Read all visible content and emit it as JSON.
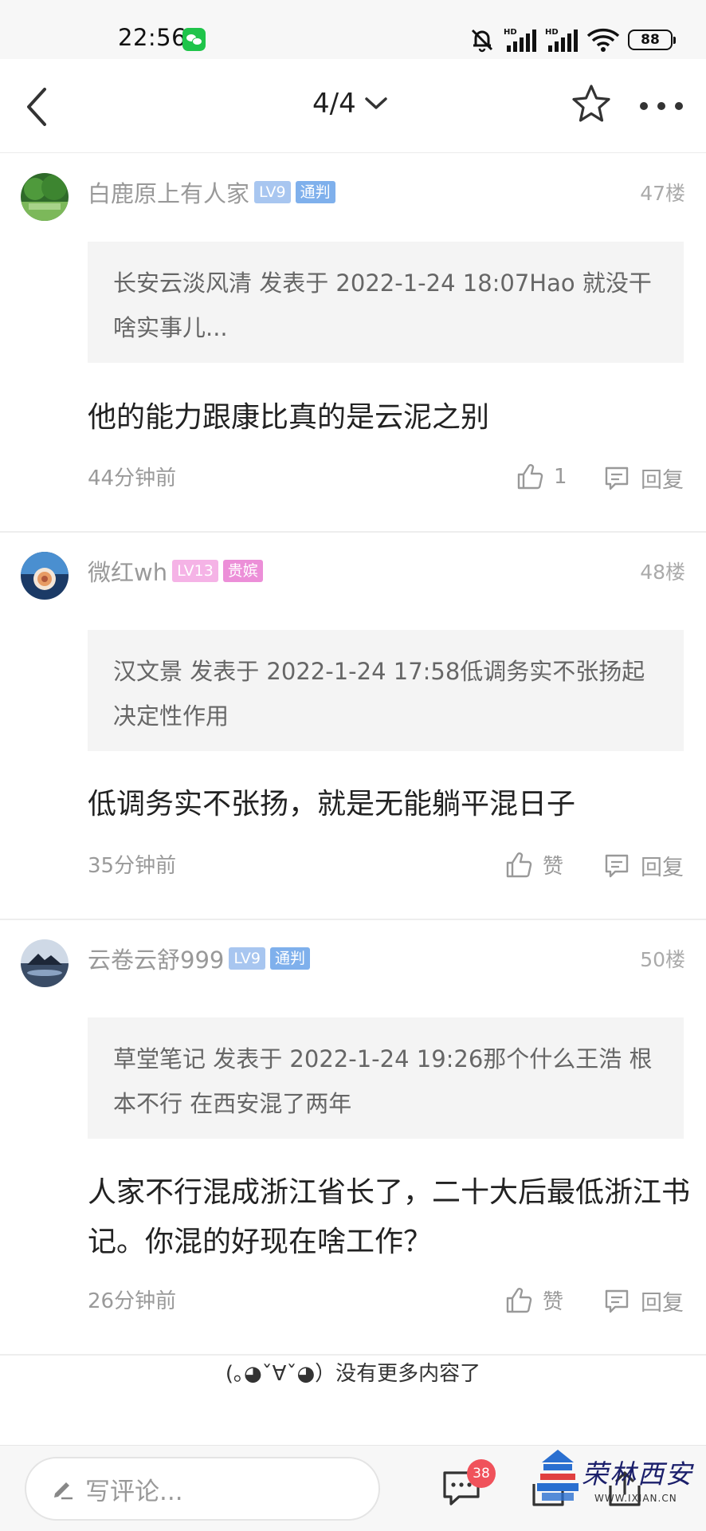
{
  "status_bar": {
    "time": "22:56",
    "battery": "88",
    "icons": [
      "wechat-icon",
      "mute-bell-icon",
      "hd-signal-icon",
      "hd-signal-icon",
      "wifi-icon",
      "battery-icon"
    ]
  },
  "nav": {
    "page_indicator": "4/4",
    "icons": [
      "back-icon",
      "chevron-down-icon",
      "star-icon",
      "more-icon"
    ]
  },
  "comments": [
    {
      "username": "白鹿原上有人家",
      "level": "LV9",
      "title": "通判",
      "floor": "47楼",
      "quote": "长安云淡风清 发表于 2022-1-24 18:07Hao 就没干啥实事儿...",
      "content": "他的能力跟康比真的是云泥之别",
      "time": "44分钟前",
      "like_label": "1",
      "reply_label": "回复"
    },
    {
      "username": "微红wh",
      "level": "LV13",
      "title": "贵嫔",
      "floor": "48楼",
      "quote": "汉文景 发表于 2022-1-24 17:58低调务实不张扬起决定性作用",
      "content": "低调务实不张扬，就是无能躺平混日子",
      "time": "35分钟前",
      "like_label": "赞",
      "reply_label": "回复"
    },
    {
      "username": "云卷云舒999",
      "level": "LV9",
      "title": "通判",
      "floor": "50楼",
      "quote": "草堂笔记 发表于 2022-1-24 19:26那个什么王浩 根本不行  在西安混了两年",
      "content": "人家不行混成浙江省长了，二十大后最低浙江书记。你混的好现在啥工作？",
      "time": "26分钟前",
      "like_label": "赞",
      "reply_label": "回复"
    }
  ],
  "end_note": "(｡◕ˇ∀ˇ◕）没有更多内容了",
  "bottom_bar": {
    "input_placeholder": "写评论...",
    "comment_count": "38",
    "icons": [
      "pencil-icon",
      "comments-icon",
      "share-icon"
    ]
  },
  "watermark": {
    "title": "荣林西安",
    "url": "WWW.IXIAN.CN"
  },
  "colors": {
    "level_badge": "#a8c6f0",
    "title_badge_blue": "#7fb0ec",
    "level_badge_pink": "#f5b3e6",
    "title_badge_pink": "#ec8fd8",
    "count_badge": "#f0525b"
  }
}
